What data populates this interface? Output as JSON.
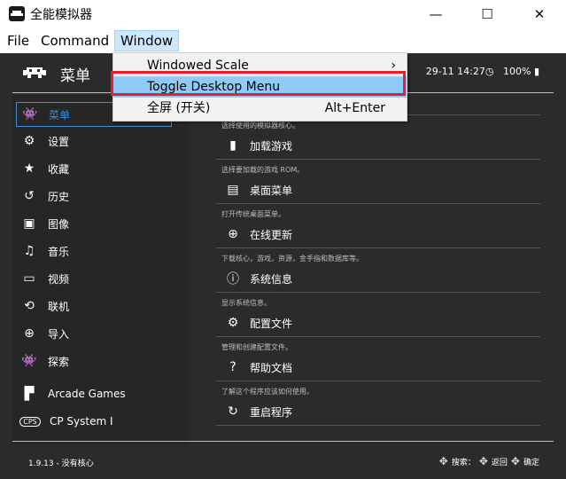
{
  "window": {
    "title": "全能模拟器",
    "min_glyph": "—",
    "max_glyph": "☐",
    "close_glyph": "✕"
  },
  "menubar": {
    "items": [
      "File",
      "Command",
      "Window"
    ]
  },
  "dropdown": {
    "items": [
      {
        "label": "Windowed Scale",
        "accel": "›"
      },
      {
        "label": "Toggle Desktop Menu",
        "accel": ""
      },
      {
        "label": "全屏 (开关)",
        "accel": "Alt+Enter"
      }
    ]
  },
  "header": {
    "title": "菜单",
    "datetime": "29-11 14:27",
    "battery": "100%"
  },
  "sidebar": {
    "items": [
      {
        "label": "菜单",
        "icon": "invader-icon",
        "glyph": "👾"
      },
      {
        "label": "设置",
        "icon": "gear-icon",
        "glyph": "⚙"
      },
      {
        "label": "收藏",
        "icon": "star-icon",
        "glyph": "★"
      },
      {
        "label": "历史",
        "icon": "history-icon",
        "glyph": "↺"
      },
      {
        "label": "图像",
        "icon": "image-icon",
        "glyph": "▣"
      },
      {
        "label": "音乐",
        "icon": "music-icon",
        "glyph": "♫"
      },
      {
        "label": "视频",
        "icon": "video-icon",
        "glyph": "▭"
      },
      {
        "label": "联机",
        "icon": "netplay-icon",
        "glyph": "⟲"
      },
      {
        "label": "导入",
        "icon": "plus-icon",
        "glyph": "⊕"
      },
      {
        "label": "探索",
        "icon": "explore-icon",
        "glyph": "👾"
      },
      {
        "label": "Arcade Games",
        "icon": "arcade-icon",
        "glyph": "▛"
      },
      {
        "label": "CP System I",
        "icon": "cps1-icon",
        "glyph": "CPS"
      }
    ]
  },
  "main": {
    "items": [
      {
        "label": "",
        "desc": "选择使用的模拟器核心。",
        "icon": "core-icon",
        "glyph": ""
      },
      {
        "label": "加载游戏",
        "desc": "选择要加载的游戏 ROM。",
        "icon": "file-icon",
        "glyph": "▮"
      },
      {
        "label": "桌面菜单",
        "desc": "打开传统桌面菜单。",
        "icon": "desktop-menu-icon",
        "glyph": "▤"
      },
      {
        "label": "在线更新",
        "desc": "下载核心，游戏，资源，金手指和数据库等。",
        "icon": "globe-icon",
        "glyph": "⊕"
      },
      {
        "label": "系统信息",
        "desc": "显示系统信息。",
        "icon": "info-icon",
        "glyph": "ⓘ"
      },
      {
        "label": "配置文件",
        "desc": "管理和创建配置文件。",
        "icon": "config-icon",
        "glyph": "⚙"
      },
      {
        "label": "帮助文档",
        "desc": "了解这个程序应该如何使用。",
        "icon": "help-icon",
        "glyph": "?"
      },
      {
        "label": "重启程序",
        "desc": "",
        "icon": "restart-icon",
        "glyph": "↻"
      }
    ]
  },
  "footer": {
    "version": "1.9.13 - 没有核心",
    "hint_search": "搜索：",
    "hint_back": "返回",
    "hint_confirm": "确定"
  }
}
